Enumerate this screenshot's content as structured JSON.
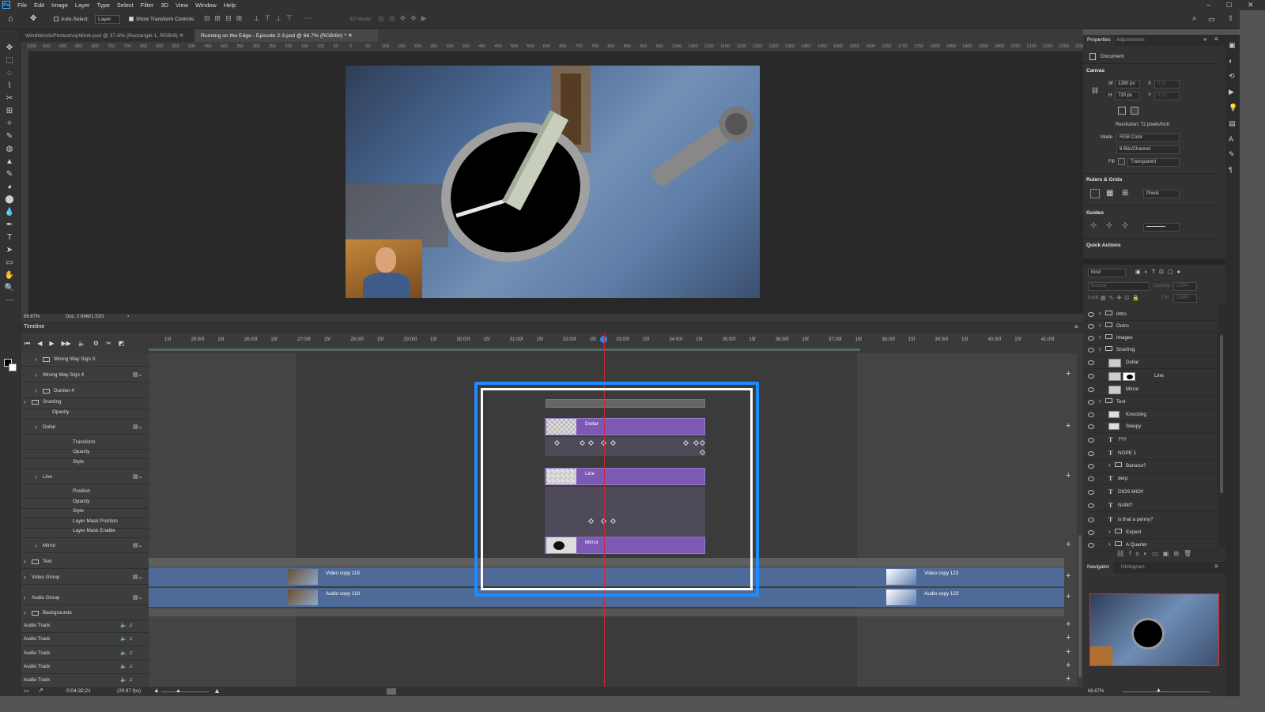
{
  "menu": [
    "File",
    "Edit",
    "Image",
    "Layer",
    "Type",
    "Select",
    "Filter",
    "3D",
    "View",
    "Window",
    "Help"
  ],
  "app_logo": "Ps",
  "options": {
    "auto_select": "Auto-Select:",
    "layer_dropdown": "Layer",
    "show_transform": "Show Transform Controls",
    "mode_3d": "3D Mode:"
  },
  "doc_tabs": [
    {
      "label": "WindWordsPhotoshopWork.psd @ 37.6% (Rectangle 1, RGB/8)",
      "active": false
    },
    {
      "label": "Running on the Edge - Episode 2-3.psd @ 66.7% (RGB/8#) *",
      "active": true
    }
  ],
  "ruler_labels": [
    "1000",
    "950",
    "900",
    "850",
    "800",
    "750",
    "700",
    "650",
    "600",
    "550",
    "500",
    "450",
    "400",
    "350",
    "300",
    "250",
    "200",
    "150",
    "100",
    "50",
    "0",
    "50",
    "100",
    "150",
    "200",
    "250",
    "300",
    "350",
    "400",
    "450",
    "500",
    "550",
    "600",
    "650",
    "700",
    "750",
    "800",
    "850",
    "900",
    "950",
    "1000",
    "1050",
    "1100",
    "1150",
    "1200",
    "1250",
    "1300",
    "1350",
    "1400",
    "1450",
    "1500",
    "1550",
    "1600",
    "1650",
    "1700",
    "1750",
    "1800",
    "1850",
    "1900",
    "1950",
    "2000",
    "2050",
    "2100",
    "2150",
    "2200",
    "2250"
  ],
  "status": {
    "zoom": "66.67%",
    "doc": "Doc: 2.64M/1.52G"
  },
  "timeline": {
    "title": "Timeline",
    "timecode": "0;04;32;21",
    "fps": "(29.97 fps)",
    "ruler_ticks": [
      "15f",
      "25:00f",
      "15f",
      "26:00f",
      "15f",
      "27:00f",
      "15f",
      "28:00f",
      "15f",
      "29:00f",
      "15f",
      "30:00f",
      "15f",
      "31:00f",
      "15f",
      "32:00f",
      "15f",
      "33:00f",
      "15f",
      "34:00f",
      "15f",
      "35:00f",
      "15f",
      "36:00f",
      "15f",
      "37:00f",
      "15f",
      "38:00f",
      "15f",
      "39:00f",
      "15f",
      "40:00f",
      "15f",
      "41:00f"
    ],
    "tracks": [
      {
        "label": "Wrong Way Sign 3"
      },
      {
        "label": "Wrong Way Sign 4"
      },
      {
        "label": "Durden 4"
      },
      {
        "label": "Snorting"
      },
      {
        "label": "Opacity"
      },
      {
        "label": "Dollar"
      },
      {
        "label": "Transform"
      },
      {
        "label": "Opacity"
      },
      {
        "label": "Style"
      },
      {
        "label": "Line"
      },
      {
        "label": "Position"
      },
      {
        "label": "Opacity"
      },
      {
        "label": "Style"
      },
      {
        "label": "Layer Mask Position"
      },
      {
        "label": "Layer Mask Enable"
      },
      {
        "label": "Mirror"
      },
      {
        "label": "Text"
      },
      {
        "label": "Video Group"
      },
      {
        "label": "Audio Group"
      },
      {
        "label": "Backgrounds"
      },
      {
        "label": "Audio Track"
      },
      {
        "label": "Audio Track"
      },
      {
        "label": "Audio Track"
      },
      {
        "label": "Audio Track"
      },
      {
        "label": "Audio Track"
      }
    ],
    "clips": {
      "dollar": "Dollar",
      "line": "Line",
      "mirror": "Mirror",
      "video1": "Video copy 119",
      "video2": "Video copy 123",
      "audio1": "Audio copy 119",
      "audio2": "Audio copy 123"
    }
  },
  "properties": {
    "tabs": [
      "Properties",
      "Adjustments"
    ],
    "doc_label": "Document",
    "canvas_title": "Canvas",
    "w_label": "W",
    "w_value": "1280 px",
    "h_label": "H",
    "h_value": "720 px",
    "x_label": "X",
    "x_value": "0 px",
    "y_label": "Y",
    "y_value": "0 px",
    "resolution": "Resolution: 72 pixels/inch",
    "mode_label": "Mode",
    "mode_value": "RGB Color",
    "bits_value": "8 Bits/Channel",
    "fill_label": "Fill",
    "fill_value": "Transparent",
    "rulers_title": "Rulers & Grids",
    "units_value": "Pixels",
    "guides_title": "Guides",
    "quick_title": "Quick Actions"
  },
  "layers": {
    "kind": "Kind",
    "blend": "Normal",
    "opacity_label": "Opacity:",
    "opacity_value": "100%",
    "lock_label": "Lock:",
    "fill_label": "Fill:",
    "fill_value": "100%",
    "items": [
      {
        "name": "Intro",
        "type": "folder",
        "indent": 0
      },
      {
        "name": "Outro",
        "type": "folder",
        "indent": 0
      },
      {
        "name": "Images",
        "type": "folder",
        "indent": 0
      },
      {
        "name": "Snorting",
        "type": "folder",
        "indent": 0
      },
      {
        "name": "Dollar",
        "type": "image",
        "indent": 1
      },
      {
        "name": "Line",
        "type": "mask",
        "indent": 1
      },
      {
        "name": "Mirror",
        "type": "image",
        "indent": 1
      },
      {
        "name": "Text",
        "type": "folder",
        "indent": 0
      },
      {
        "name": "Knocking",
        "type": "video",
        "indent": 1
      },
      {
        "name": "Sleepy",
        "type": "video",
        "indent": 1
      },
      {
        "name": "???",
        "type": "text",
        "indent": 1
      },
      {
        "name": "NOPE 1",
        "type": "text",
        "indent": 1
      },
      {
        "name": "Banana?",
        "type": "folder",
        "indent": 1
      },
      {
        "name": "derp",
        "type": "text",
        "indent": 1
      },
      {
        "name": "DIOS MIO!!",
        "type": "text",
        "indent": 1
      },
      {
        "name": "NANI?",
        "type": "text",
        "indent": 1
      },
      {
        "name": "is that a penny?",
        "type": "text",
        "indent": 1
      },
      {
        "name": "Expect",
        "type": "folder",
        "indent": 1
      },
      {
        "name": "A Quarter",
        "type": "folder",
        "indent": 1
      }
    ]
  },
  "navigator": {
    "tabs": [
      "Navigator",
      "Histogram"
    ],
    "zoom": "66.67%"
  },
  "colors": {
    "highlight": "#1e8bff",
    "clip_purple": "#7b59b5",
    "clip_blue": "#4e6a98",
    "playhead": "#c8283a"
  }
}
